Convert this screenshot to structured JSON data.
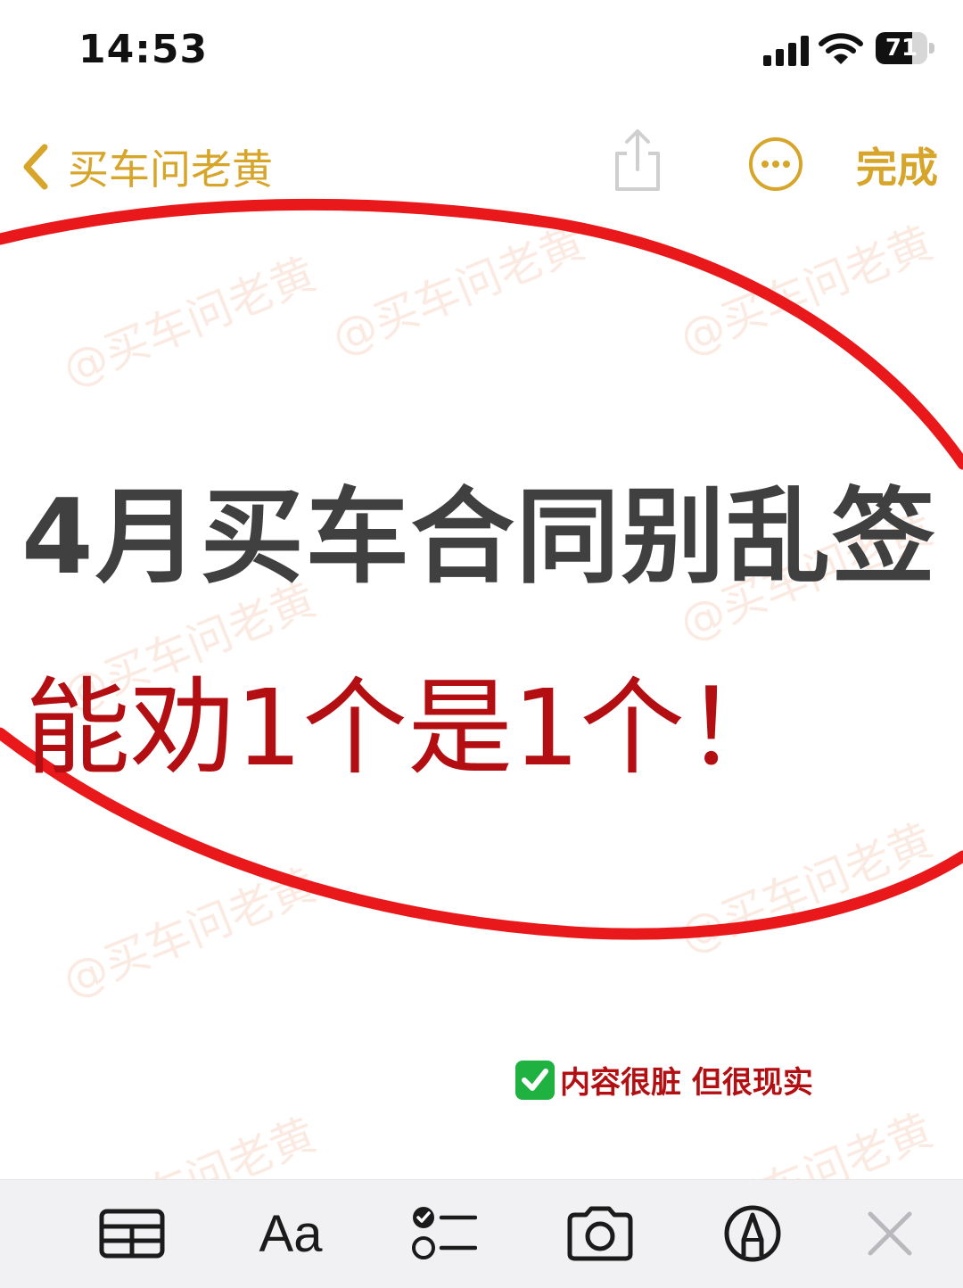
{
  "status_bar": {
    "time": "14:53",
    "battery": "71",
    "battery_level": 0.71
  },
  "nav": {
    "back_label": "买车问老黄",
    "done_label": "完成"
  },
  "watermark": "@买车问老黄",
  "note": {
    "headline": "4月买车合同别乱签",
    "subheadline": "能劝1个是1个！",
    "footnote": "内容很脏 但很现实"
  },
  "toolbar": {
    "format_label": "Aa"
  },
  "colors": {
    "accent": "#d6a52a",
    "headline": "#404040",
    "emphasis": "#b30f12",
    "ellipse": "#e8181b",
    "check": "#1fb241"
  },
  "icons": [
    "chevron-left-icon",
    "share-icon",
    "more-icon",
    "table-icon",
    "checklist-icon",
    "camera-icon",
    "markup-icon",
    "close-icon"
  ]
}
